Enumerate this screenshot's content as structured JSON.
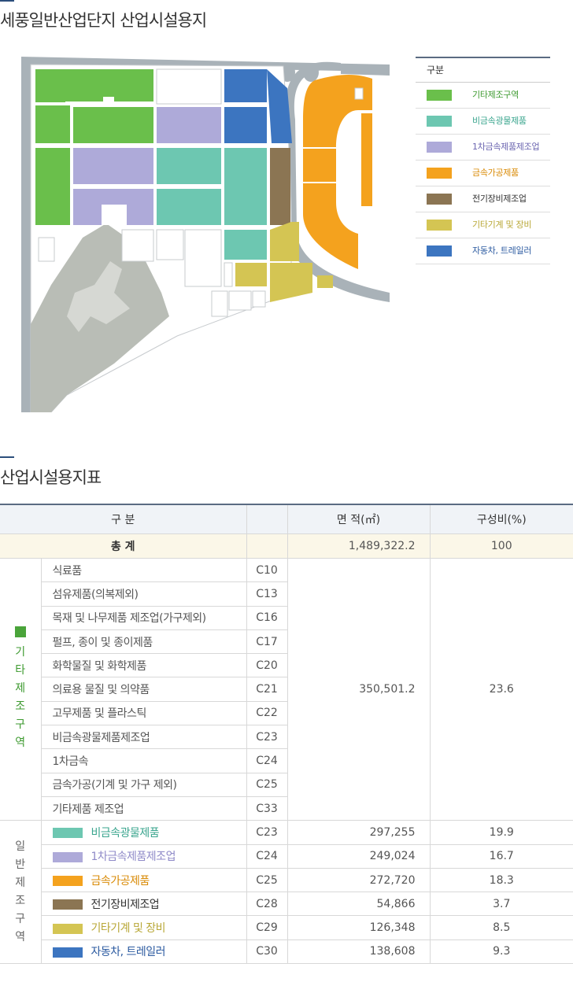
{
  "section1": {
    "title": "세풍일반산업단지 산업시설용지"
  },
  "section2": {
    "title": "산업시설용지표"
  },
  "colors": {
    "green": "#6abf4b",
    "mint": "#6dc7b1",
    "lavender": "#aeaad9",
    "orange": "#f4a21e",
    "brown": "#8b7553",
    "yellow": "#d4c553",
    "blue": "#3c75c0",
    "road": "#a9b2b8",
    "hill": "#b9bdb6"
  },
  "legend": {
    "header": "구분",
    "items": [
      {
        "label": "기타제조구역",
        "color": "#6abf4b",
        "text_color": "#3d9a2f"
      },
      {
        "label": "비금속광물제품",
        "color": "#6dc7b1",
        "text_color": "#3aa58e"
      },
      {
        "label": "1차금속제품제조업",
        "color": "#aeaad9",
        "text_color": "#6b65b0"
      },
      {
        "label": "금속가공제품",
        "color": "#f4a21e",
        "text_color": "#d98a05"
      },
      {
        "label": "전기장비제조업",
        "color": "#8b7553",
        "text_color": "#333333"
      },
      {
        "label": "기타기계 및 장비",
        "color": "#d4c553",
        "text_color": "#b8a736"
      },
      {
        "label": "자동차, 트레일러",
        "color": "#3c75c0",
        "text_color": "#2b5aa0"
      }
    ]
  },
  "table": {
    "headers": {
      "category": "구 분",
      "area": "면 적(㎡)",
      "ratio": "구성비(%)"
    },
    "total": {
      "label": "총 계",
      "area": "1,489,322.2",
      "ratio": "100"
    },
    "group1": {
      "label_chars": [
        "기",
        "타",
        "제",
        "조",
        "구",
        "역"
      ],
      "swatch_color": "#4aa43a",
      "label_color": "#3d9a2f",
      "area": "350,501.2",
      "ratio": "23.6",
      "rows": [
        {
          "name": "식료품",
          "code": "C10"
        },
        {
          "name": "섬유제품(의복제외)",
          "code": "C13"
        },
        {
          "name": "목재 및 나무제품 제조업(가구제외)",
          "code": "C16"
        },
        {
          "name": "펄프, 종이 및 종이제품",
          "code": "C17"
        },
        {
          "name": "화학물질 및 화학제품",
          "code": "C20"
        },
        {
          "name": "의료용 물질 및 의약품",
          "code": "C21"
        },
        {
          "name": "고무제품 및 플라스틱",
          "code": "C22"
        },
        {
          "name": "비금속광물제품제조업",
          "code": "C23"
        },
        {
          "name": "1차금속",
          "code": "C24"
        },
        {
          "name": "금속가공(기계 및 가구 제외)",
          "code": "C25"
        },
        {
          "name": "기타제품 제조업",
          "code": "C33"
        }
      ]
    },
    "group2": {
      "label_chars": [
        "일",
        "반",
        "제",
        "조",
        "구",
        "역"
      ],
      "rows": [
        {
          "name": "비금속광물제품",
          "code": "C23",
          "area": "297,255",
          "ratio": "19.9",
          "color": "#6dc7b1",
          "text_color": "#3aa58e"
        },
        {
          "name": "1차금속제품제조업",
          "code": "C24",
          "area": "249,024",
          "ratio": "16.7",
          "color": "#aeaad9",
          "text_color": "#8f8ac8"
        },
        {
          "name": "금속가공제품",
          "code": "C25",
          "area": "272,720",
          "ratio": "18.3",
          "color": "#f4a21e",
          "text_color": "#d98a05"
        },
        {
          "name": "전기장비제조업",
          "code": "C28",
          "area": "54,866",
          "ratio": "3.7",
          "color": "#8b7553",
          "text_color": "#333333"
        },
        {
          "name": "기타기계 및 장비",
          "code": "C29",
          "area": "126,348",
          "ratio": "8.5",
          "color": "#d4c553",
          "text_color": "#b8a736"
        },
        {
          "name": "자동차, 트레일러",
          "code": "C30",
          "area": "138,608",
          "ratio": "9.3",
          "color": "#3c75c0",
          "text_color": "#2b5aa0"
        }
      ]
    }
  }
}
